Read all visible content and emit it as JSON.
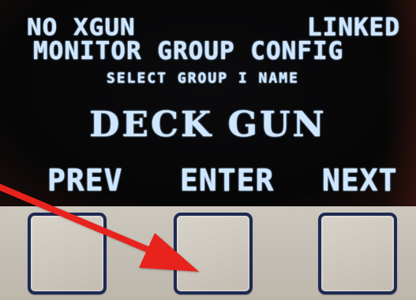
{
  "display": {
    "status_left": "NO XGUN",
    "status_right": "LINKED",
    "title": "MONITOR GROUP CONFIG",
    "subtitle": "SELECT GROUP I NAME",
    "selected_value": "DECK GUN",
    "softkeys": {
      "prev": "PREV",
      "enter": "ENTER",
      "next": "NEXT"
    }
  },
  "colors": {
    "oled_text": "#cfe6ff",
    "key_border": "#1e2a52",
    "keypad_face": "#c8c3b9",
    "annotation_arrow": "#e8231c"
  },
  "annotation": {
    "icon": "red-arrow-icon",
    "points_to": "enter-key"
  }
}
